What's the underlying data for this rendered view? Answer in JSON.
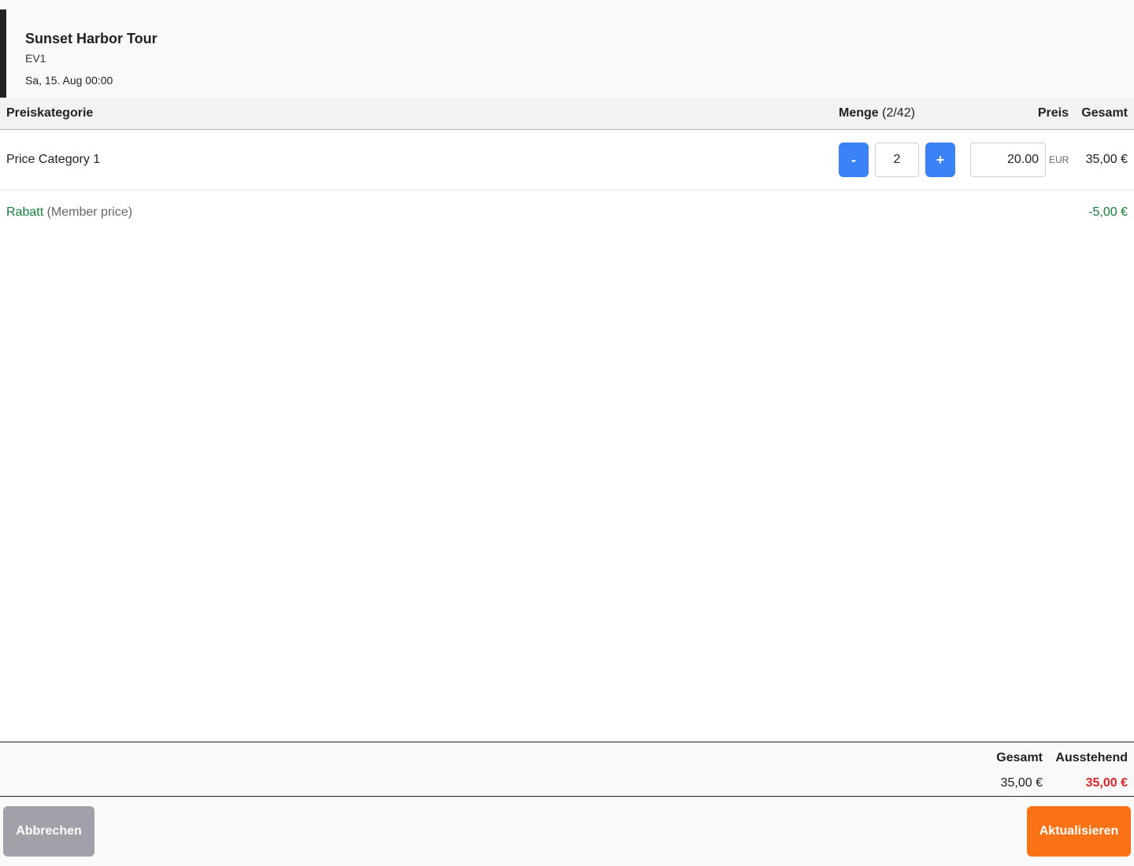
{
  "event": {
    "title": "Sunset Harbor Tour",
    "code": "EV1",
    "date": "Sa, 15. Aug 00:00"
  },
  "table": {
    "headers": {
      "category": "Preiskategorie",
      "quantity": "Menge",
      "quantity_info": "(2/42)",
      "price": "Preis",
      "total": "Gesamt"
    },
    "rows": [
      {
        "category": "Price Category 1",
        "decrement_label": "-",
        "quantity": "2",
        "increment_label": "+",
        "price": "20.00",
        "currency": "EUR",
        "total": "35,00 €"
      }
    ]
  },
  "discount": {
    "label": "Rabatt",
    "note": "(Member price)",
    "value": "-5,00 €"
  },
  "summary": {
    "total_label": "Gesamt",
    "total_value": "35,00 €",
    "outstanding_label": "Ausstehend",
    "outstanding_value": "35,00 €"
  },
  "footer": {
    "cancel_label": "Abbrechen",
    "update_label": "Aktualisieren"
  },
  "colors": {
    "primary_blue": "#3b82f6",
    "discount_green": "#15803d",
    "outstanding_red": "#dc2626",
    "update_orange": "#f97316",
    "cancel_gray": "#a1a1aa"
  }
}
